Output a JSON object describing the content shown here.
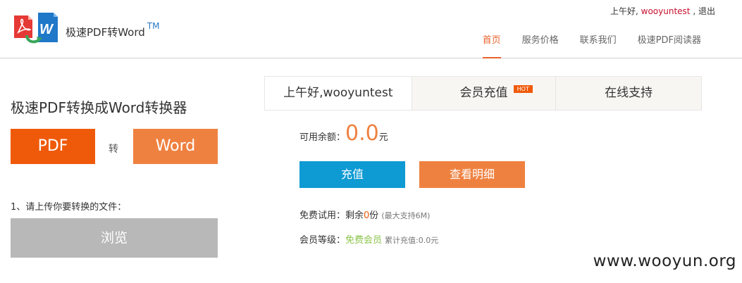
{
  "header": {
    "brand": "极速PDF转Word",
    "brand_tm": "TM",
    "greeting": "上午好,",
    "username": "wooyuntest",
    "separator": ",",
    "logout": "退出"
  },
  "nav": {
    "items": [
      {
        "label": "首页",
        "active": true
      },
      {
        "label": "服务价格",
        "active": false
      },
      {
        "label": "联系我们",
        "active": false
      },
      {
        "label": "极速PDF阅读器",
        "active": false
      }
    ]
  },
  "converter": {
    "title": "极速PDF转换成Word转换器",
    "pdf_label": "PDF",
    "to_label": "转",
    "word_label": "Word",
    "step1": "1、请上传你要转换的文件：",
    "browse_label": "浏览"
  },
  "account": {
    "tabs": [
      {
        "label": "上午好,wooyuntest",
        "active": true
      },
      {
        "label": "会员充值",
        "badge": "HOT"
      },
      {
        "label": "在线支持"
      }
    ],
    "balance_label": "可用余额：",
    "balance_value": "0.0",
    "balance_unit": "元",
    "recharge_label": "充值",
    "detail_label": "查看明细",
    "trial_label": "免费试用：剩余",
    "trial_count": "0",
    "trial_unit": "份",
    "trial_note": "(最大支持6M)",
    "level_label": "会员等级：",
    "level_value": "免费会员",
    "level_note": "累计充值:0.0元"
  },
  "watermark": "www.wooyun.org",
  "colors": {
    "accent": "#ef5a0a",
    "orange_light": "#ef8140",
    "blue": "#0e9ad3",
    "username": "#c8102e",
    "green": "#8bc34a",
    "gray_button": "#b8b8b8"
  }
}
